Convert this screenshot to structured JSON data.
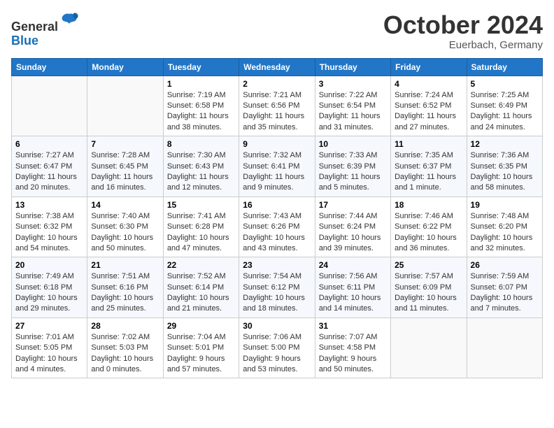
{
  "header": {
    "logo_line1": "General",
    "logo_line2": "Blue",
    "month": "October 2024",
    "location": "Euerbach, Germany"
  },
  "weekdays": [
    "Sunday",
    "Monday",
    "Tuesday",
    "Wednesday",
    "Thursday",
    "Friday",
    "Saturday"
  ],
  "weeks": [
    [
      {
        "day": "",
        "info": ""
      },
      {
        "day": "",
        "info": ""
      },
      {
        "day": "1",
        "info": "Sunrise: 7:19 AM\nSunset: 6:58 PM\nDaylight: 11 hours and 38 minutes."
      },
      {
        "day": "2",
        "info": "Sunrise: 7:21 AM\nSunset: 6:56 PM\nDaylight: 11 hours and 35 minutes."
      },
      {
        "day": "3",
        "info": "Sunrise: 7:22 AM\nSunset: 6:54 PM\nDaylight: 11 hours and 31 minutes."
      },
      {
        "day": "4",
        "info": "Sunrise: 7:24 AM\nSunset: 6:52 PM\nDaylight: 11 hours and 27 minutes."
      },
      {
        "day": "5",
        "info": "Sunrise: 7:25 AM\nSunset: 6:49 PM\nDaylight: 11 hours and 24 minutes."
      }
    ],
    [
      {
        "day": "6",
        "info": "Sunrise: 7:27 AM\nSunset: 6:47 PM\nDaylight: 11 hours and 20 minutes."
      },
      {
        "day": "7",
        "info": "Sunrise: 7:28 AM\nSunset: 6:45 PM\nDaylight: 11 hours and 16 minutes."
      },
      {
        "day": "8",
        "info": "Sunrise: 7:30 AM\nSunset: 6:43 PM\nDaylight: 11 hours and 12 minutes."
      },
      {
        "day": "9",
        "info": "Sunrise: 7:32 AM\nSunset: 6:41 PM\nDaylight: 11 hours and 9 minutes."
      },
      {
        "day": "10",
        "info": "Sunrise: 7:33 AM\nSunset: 6:39 PM\nDaylight: 11 hours and 5 minutes."
      },
      {
        "day": "11",
        "info": "Sunrise: 7:35 AM\nSunset: 6:37 PM\nDaylight: 11 hours and 1 minute."
      },
      {
        "day": "12",
        "info": "Sunrise: 7:36 AM\nSunset: 6:35 PM\nDaylight: 10 hours and 58 minutes."
      }
    ],
    [
      {
        "day": "13",
        "info": "Sunrise: 7:38 AM\nSunset: 6:32 PM\nDaylight: 10 hours and 54 minutes."
      },
      {
        "day": "14",
        "info": "Sunrise: 7:40 AM\nSunset: 6:30 PM\nDaylight: 10 hours and 50 minutes."
      },
      {
        "day": "15",
        "info": "Sunrise: 7:41 AM\nSunset: 6:28 PM\nDaylight: 10 hours and 47 minutes."
      },
      {
        "day": "16",
        "info": "Sunrise: 7:43 AM\nSunset: 6:26 PM\nDaylight: 10 hours and 43 minutes."
      },
      {
        "day": "17",
        "info": "Sunrise: 7:44 AM\nSunset: 6:24 PM\nDaylight: 10 hours and 39 minutes."
      },
      {
        "day": "18",
        "info": "Sunrise: 7:46 AM\nSunset: 6:22 PM\nDaylight: 10 hours and 36 minutes."
      },
      {
        "day": "19",
        "info": "Sunrise: 7:48 AM\nSunset: 6:20 PM\nDaylight: 10 hours and 32 minutes."
      }
    ],
    [
      {
        "day": "20",
        "info": "Sunrise: 7:49 AM\nSunset: 6:18 PM\nDaylight: 10 hours and 29 minutes."
      },
      {
        "day": "21",
        "info": "Sunrise: 7:51 AM\nSunset: 6:16 PM\nDaylight: 10 hours and 25 minutes."
      },
      {
        "day": "22",
        "info": "Sunrise: 7:52 AM\nSunset: 6:14 PM\nDaylight: 10 hours and 21 minutes."
      },
      {
        "day": "23",
        "info": "Sunrise: 7:54 AM\nSunset: 6:12 PM\nDaylight: 10 hours and 18 minutes."
      },
      {
        "day": "24",
        "info": "Sunrise: 7:56 AM\nSunset: 6:11 PM\nDaylight: 10 hours and 14 minutes."
      },
      {
        "day": "25",
        "info": "Sunrise: 7:57 AM\nSunset: 6:09 PM\nDaylight: 10 hours and 11 minutes."
      },
      {
        "day": "26",
        "info": "Sunrise: 7:59 AM\nSunset: 6:07 PM\nDaylight: 10 hours and 7 minutes."
      }
    ],
    [
      {
        "day": "27",
        "info": "Sunrise: 7:01 AM\nSunset: 5:05 PM\nDaylight: 10 hours and 4 minutes."
      },
      {
        "day": "28",
        "info": "Sunrise: 7:02 AM\nSunset: 5:03 PM\nDaylight: 10 hours and 0 minutes."
      },
      {
        "day": "29",
        "info": "Sunrise: 7:04 AM\nSunset: 5:01 PM\nDaylight: 9 hours and 57 minutes."
      },
      {
        "day": "30",
        "info": "Sunrise: 7:06 AM\nSunset: 5:00 PM\nDaylight: 9 hours and 53 minutes."
      },
      {
        "day": "31",
        "info": "Sunrise: 7:07 AM\nSunset: 4:58 PM\nDaylight: 9 hours and 50 minutes."
      },
      {
        "day": "",
        "info": ""
      },
      {
        "day": "",
        "info": ""
      }
    ]
  ]
}
